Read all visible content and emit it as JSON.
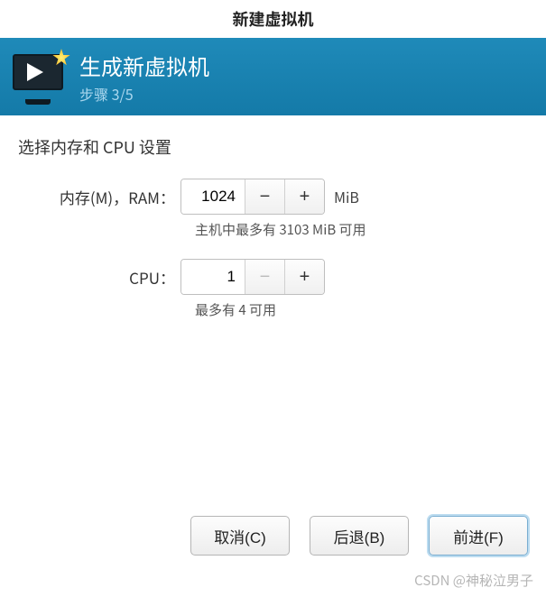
{
  "window": {
    "title": "新建虚拟机"
  },
  "header": {
    "title": "生成新虚拟机",
    "step": "步骤 3/5"
  },
  "section": {
    "title": "选择内存和 CPU 设置"
  },
  "memory": {
    "label": "内存(M)，RAM：",
    "value": "1024",
    "unit": "MiB",
    "hint": "主机中最多有 3103 MiB 可用"
  },
  "cpu": {
    "label": "CPU：",
    "value": "1",
    "hint": "最多有 4 可用"
  },
  "buttons": {
    "cancel": "取消(C)",
    "back": "后退(B)",
    "forward": "前进(F)"
  },
  "watermark": "CSDN @神秘泣男子"
}
